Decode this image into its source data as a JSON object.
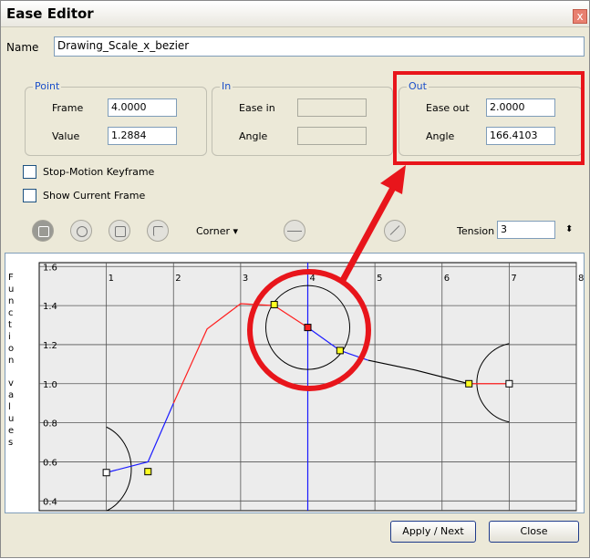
{
  "window": {
    "title": "Ease Editor",
    "close_glyph": "x"
  },
  "name_field": {
    "label": "Name",
    "value": "Drawing_Scale_x_bezier"
  },
  "point_group": {
    "legend": "Point",
    "frame_label": "Frame",
    "frame_value": "4.0000",
    "value_label": "Value",
    "value_value": "1.2884"
  },
  "in_group": {
    "legend": "In",
    "ease_in_label": "Ease in",
    "angle_label": "Angle"
  },
  "out_group": {
    "legend": "Out",
    "ease_out_label": "Ease out",
    "ease_out_value": "2.0000",
    "angle_label": "Angle",
    "angle_value": "166.4103"
  },
  "checkboxes": {
    "stop_motion": "Stop-Motion Keyframe",
    "show_current": "Show Current Frame"
  },
  "toolbar": {
    "corner_label": "Corner ▾",
    "tension_label": "Tension",
    "tension_value": "3"
  },
  "buttons": {
    "apply_next": "Apply / Next",
    "close": "Close"
  },
  "highlight_color": "#e8151b",
  "chart_data": {
    "type": "line",
    "ylabel": "Function values",
    "xlim": [
      0,
      8
    ],
    "ylim": [
      0.35,
      1.62
    ],
    "x_ticks": [
      "1",
      "2",
      "3",
      "4",
      "5",
      "6",
      "7",
      "8"
    ],
    "y_ticks": [
      "1.6",
      "1.4",
      "1.2",
      "1.0",
      "0.8",
      "0.6",
      "0.4"
    ],
    "current_frame": 4,
    "series": [
      {
        "color": "#1a1aff",
        "points": [
          [
            1,
            0.545
          ],
          [
            1.62,
            0.6
          ],
          [
            2.0,
            0.9
          ]
        ]
      },
      {
        "color": "#ff2020",
        "points": [
          [
            2.0,
            0.9
          ],
          [
            2.5,
            1.28
          ],
          [
            3.0,
            1.41
          ],
          [
            3.5,
            1.4
          ],
          [
            4.0,
            1.288
          ]
        ]
      },
      {
        "color": "#1a1aff",
        "points": [
          [
            4.0,
            1.288
          ],
          [
            4.48,
            1.17
          ],
          [
            4.9,
            1.12
          ]
        ]
      },
      {
        "color": "#000000",
        "points": [
          [
            4.9,
            1.12
          ],
          [
            5.6,
            1.07
          ],
          [
            6.4,
            1.0
          ]
        ]
      },
      {
        "color": "#ff2020",
        "points": [
          [
            6.4,
            1.0
          ],
          [
            7.0,
            1.0
          ]
        ]
      }
    ],
    "keyframes": [
      [
        1,
        0.545
      ],
      [
        4,
        1.288
      ],
      [
        7,
        1.0
      ]
    ],
    "handles": [
      [
        1.62,
        0.55
      ],
      [
        3.5,
        1.405
      ],
      [
        4.48,
        1.17
      ],
      [
        6.4,
        1.0
      ]
    ]
  }
}
